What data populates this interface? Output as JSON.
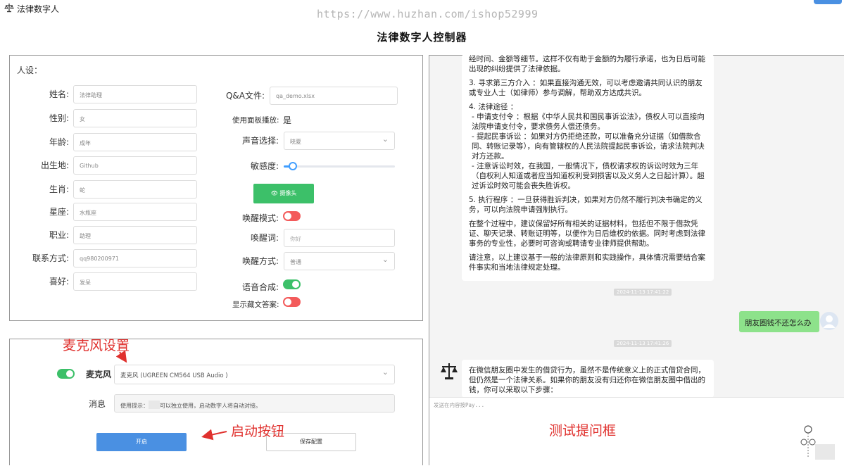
{
  "window": {
    "title": "法律数字人"
  },
  "watermark": "https://www.huzhan.com/ishop52999",
  "page_title": "法律数字人控制器",
  "persona": {
    "section_label": "人设：",
    "fields": [
      {
        "label": "姓名:",
        "value": "法律助理"
      },
      {
        "label": "性别:",
        "value": "女"
      },
      {
        "label": "年龄:",
        "value": "成年"
      },
      {
        "label": "出生地:",
        "value": "Github"
      },
      {
        "label": "生肖:",
        "value": "蛇"
      },
      {
        "label": "星座:",
        "value": "水瓶座"
      },
      {
        "label": "职业:",
        "value": "助理"
      },
      {
        "label": "联系方式:",
        "value": "qq980200971"
      },
      {
        "label": "喜好:",
        "value": "发呆"
      }
    ],
    "qa_label": "Q&A文件:",
    "qa_value": "qa_demo.xlsx",
    "panel_play_label": "使用面板播放:",
    "panel_play_value": "是",
    "voice_label": "声音选择:",
    "voice_value": "晓夏",
    "sensitivity_label": "敏感度:",
    "sensitivity_level": 0.08,
    "camera_button": "摄像头",
    "wake_mode_label": "唤醒模式:",
    "wake_mode_on": false,
    "wake_word_label": "唤醒词:",
    "wake_word_placeholder": "你好",
    "wake_method_label": "唤醒方式:",
    "wake_method_value": "普通",
    "tts_label": "语音合成:",
    "tts_on": true,
    "show_hidden_label": "显示藏文答案:",
    "show_hidden_on": false
  },
  "mic": {
    "annotation": "麦克风设置",
    "toggle_on": true,
    "label": "麦克风",
    "value": "麦克风 (UGREEN CM564 USB Audio )",
    "message_label": "消息",
    "message_prefix": "使用提示：",
    "message_suffix": "可以独立使用，启动数字人将自动对接。",
    "start_button": "开启",
    "start_annotation": "启动按钮",
    "save_button": "保存配置"
  },
  "chat": {
    "answer_paragraphs": [
      "经时间、金额等细节。这样不仅有助于金额的为履行承诺，也为日后可能出现的纠纷提供了法律依据。",
      "3. 寻求第三方介入 ：如果直接沟通无效，可以考虑邀请共同认识的朋友或专业人士（如律师）参与调解，帮助双方达成共识。",
      "4. 法律途径 ：",
      "- 申请支付令 ：根据《中华人民共和国民事诉讼法》，债权人可以直接向法院申请支付令，要求债务人偿还债务。",
      "- 提起民事诉讼 ：如果对方仍拒绝还款，可以准备充分证据（如借款合同、转账记录等），向有管辖权的人民法院提起民事诉讼，请求法院判决对方还款。",
      "- 注意诉讼时效，在我国，一般情况下，债权请求权的诉讼时效为三年（自权利人知道或者应当知道权利受到损害以及义务人之日起计算）。超过诉讼时效可能会丧失胜诉权。",
      "5. 执行程序 ：一旦获得胜诉判决，如果对方仍然不履行判决书确定的义务，可以向法院申请强制执行。",
      "在整个过程中，建议保留好所有相关的证据材料，包括但不限于借款凭证、聊天记录、转账证明等，以便作为日后维权的依据。同时考虑到法律事务的专业性，必要时可咨询或聘请专业律师提供帮助。",
      "请注意，以上建议基于一般的法律原则和实践操作，具体情况需要结合案件事实和当地法律规定处理。"
    ],
    "timestamp_1": "2024-11-13 17:41:22",
    "user_message": "朋友圈钱不还怎么办",
    "timestamp_2": "2024-11-13 17:41:26",
    "answer2_text": "在微信朋友圈中发生的借贷行为，虽然不是传统意义上的正式借贷合同，但仍然是一个法律关系。如果你的朋友没有归还你在微信朋友圈中借出的钱，你可以采取以下步骤：",
    "input_placeholder": "发送在内容按Pay...",
    "input_annotation": "测试提问框"
  },
  "colors": {
    "green": "#3cc069",
    "red_toggle": "#f35b5b",
    "blue_button": "#4a90e2",
    "annotation_red": "#e0312e",
    "user_bubble": "#8de28b"
  }
}
